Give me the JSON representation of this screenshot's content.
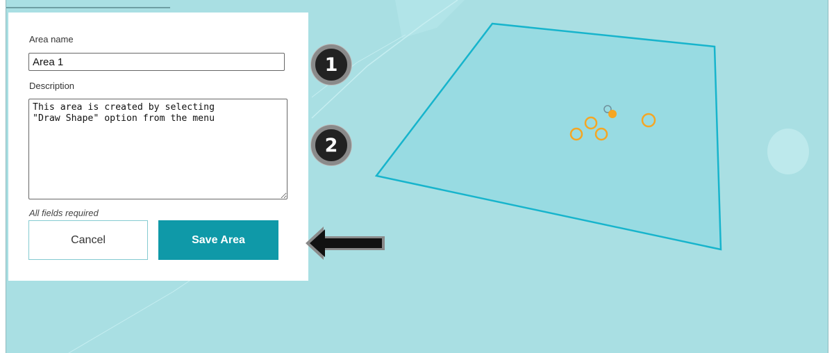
{
  "form": {
    "area_name_label": "Area name",
    "area_name_value": "Area 1",
    "description_label": "Description",
    "description_value": "This area is created by selecting\n\"Draw Shape\" option from the menu",
    "required_note": "All fields required",
    "cancel_label": "Cancel",
    "save_label": "Save Area"
  },
  "callouts": {
    "step1": "1",
    "step2": "2"
  },
  "colors": {
    "map_background": "#a9dfe3",
    "polygon_stroke": "#17b4cc",
    "polygon_fill": "#8fd6e0",
    "marker_orange": "#f5a623",
    "save_button": "#0f99a8"
  }
}
